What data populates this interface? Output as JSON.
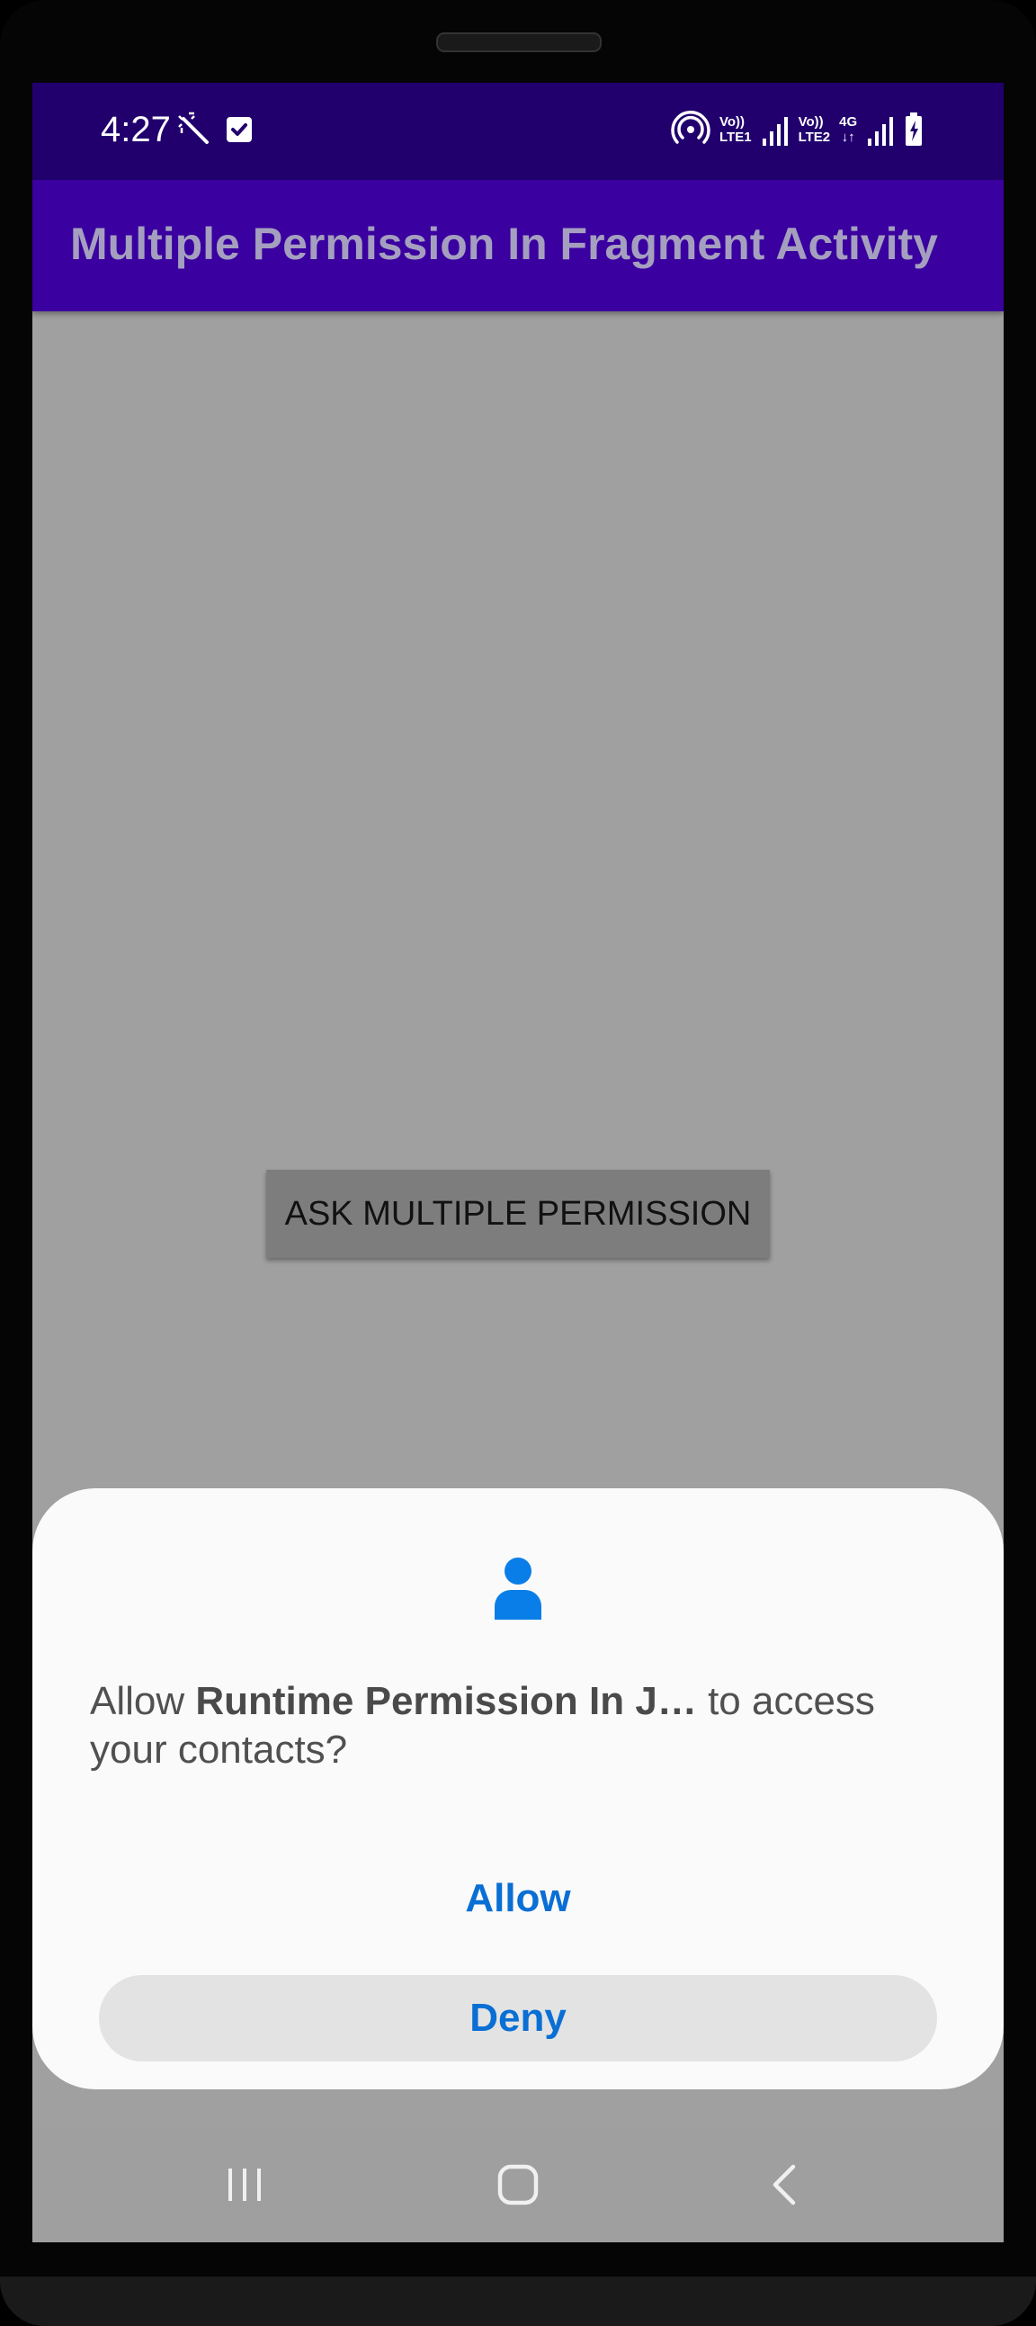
{
  "status_bar": {
    "time": "4:27",
    "icons": [
      "magic-wand-icon",
      "checkbox-icon",
      "hotspot-icon",
      "signal-sim1-icon",
      "signal-sim2-icon",
      "battery-charging-icon"
    ],
    "sim1_top": "Vo))",
    "sim1_bottom": "LTE1",
    "sim2_top": "Vo))",
    "sim2_bottom": "LTE2",
    "net_type": "4G",
    "net_arrows": "↓↑"
  },
  "app_bar": {
    "title": "Multiple Permission In Fragment Activity"
  },
  "main": {
    "button_label": "ASK MULTIPLE PERMISSION"
  },
  "dialog": {
    "icon": "contact-person-icon",
    "message_prefix": "Allow ",
    "app_name": "Runtime Permission In J…",
    "message_suffix": " to access your contacts?",
    "allow_label": "Allow",
    "deny_label": "Deny"
  },
  "nav_bar": {
    "icons": [
      "recent-apps-icon",
      "home-icon",
      "back-icon"
    ]
  },
  "colors": {
    "status_bar": "#21006e",
    "app_bar": "#3a00a0",
    "accent": "#0a6fd4",
    "scrim_background": "#a0a0a0"
  }
}
